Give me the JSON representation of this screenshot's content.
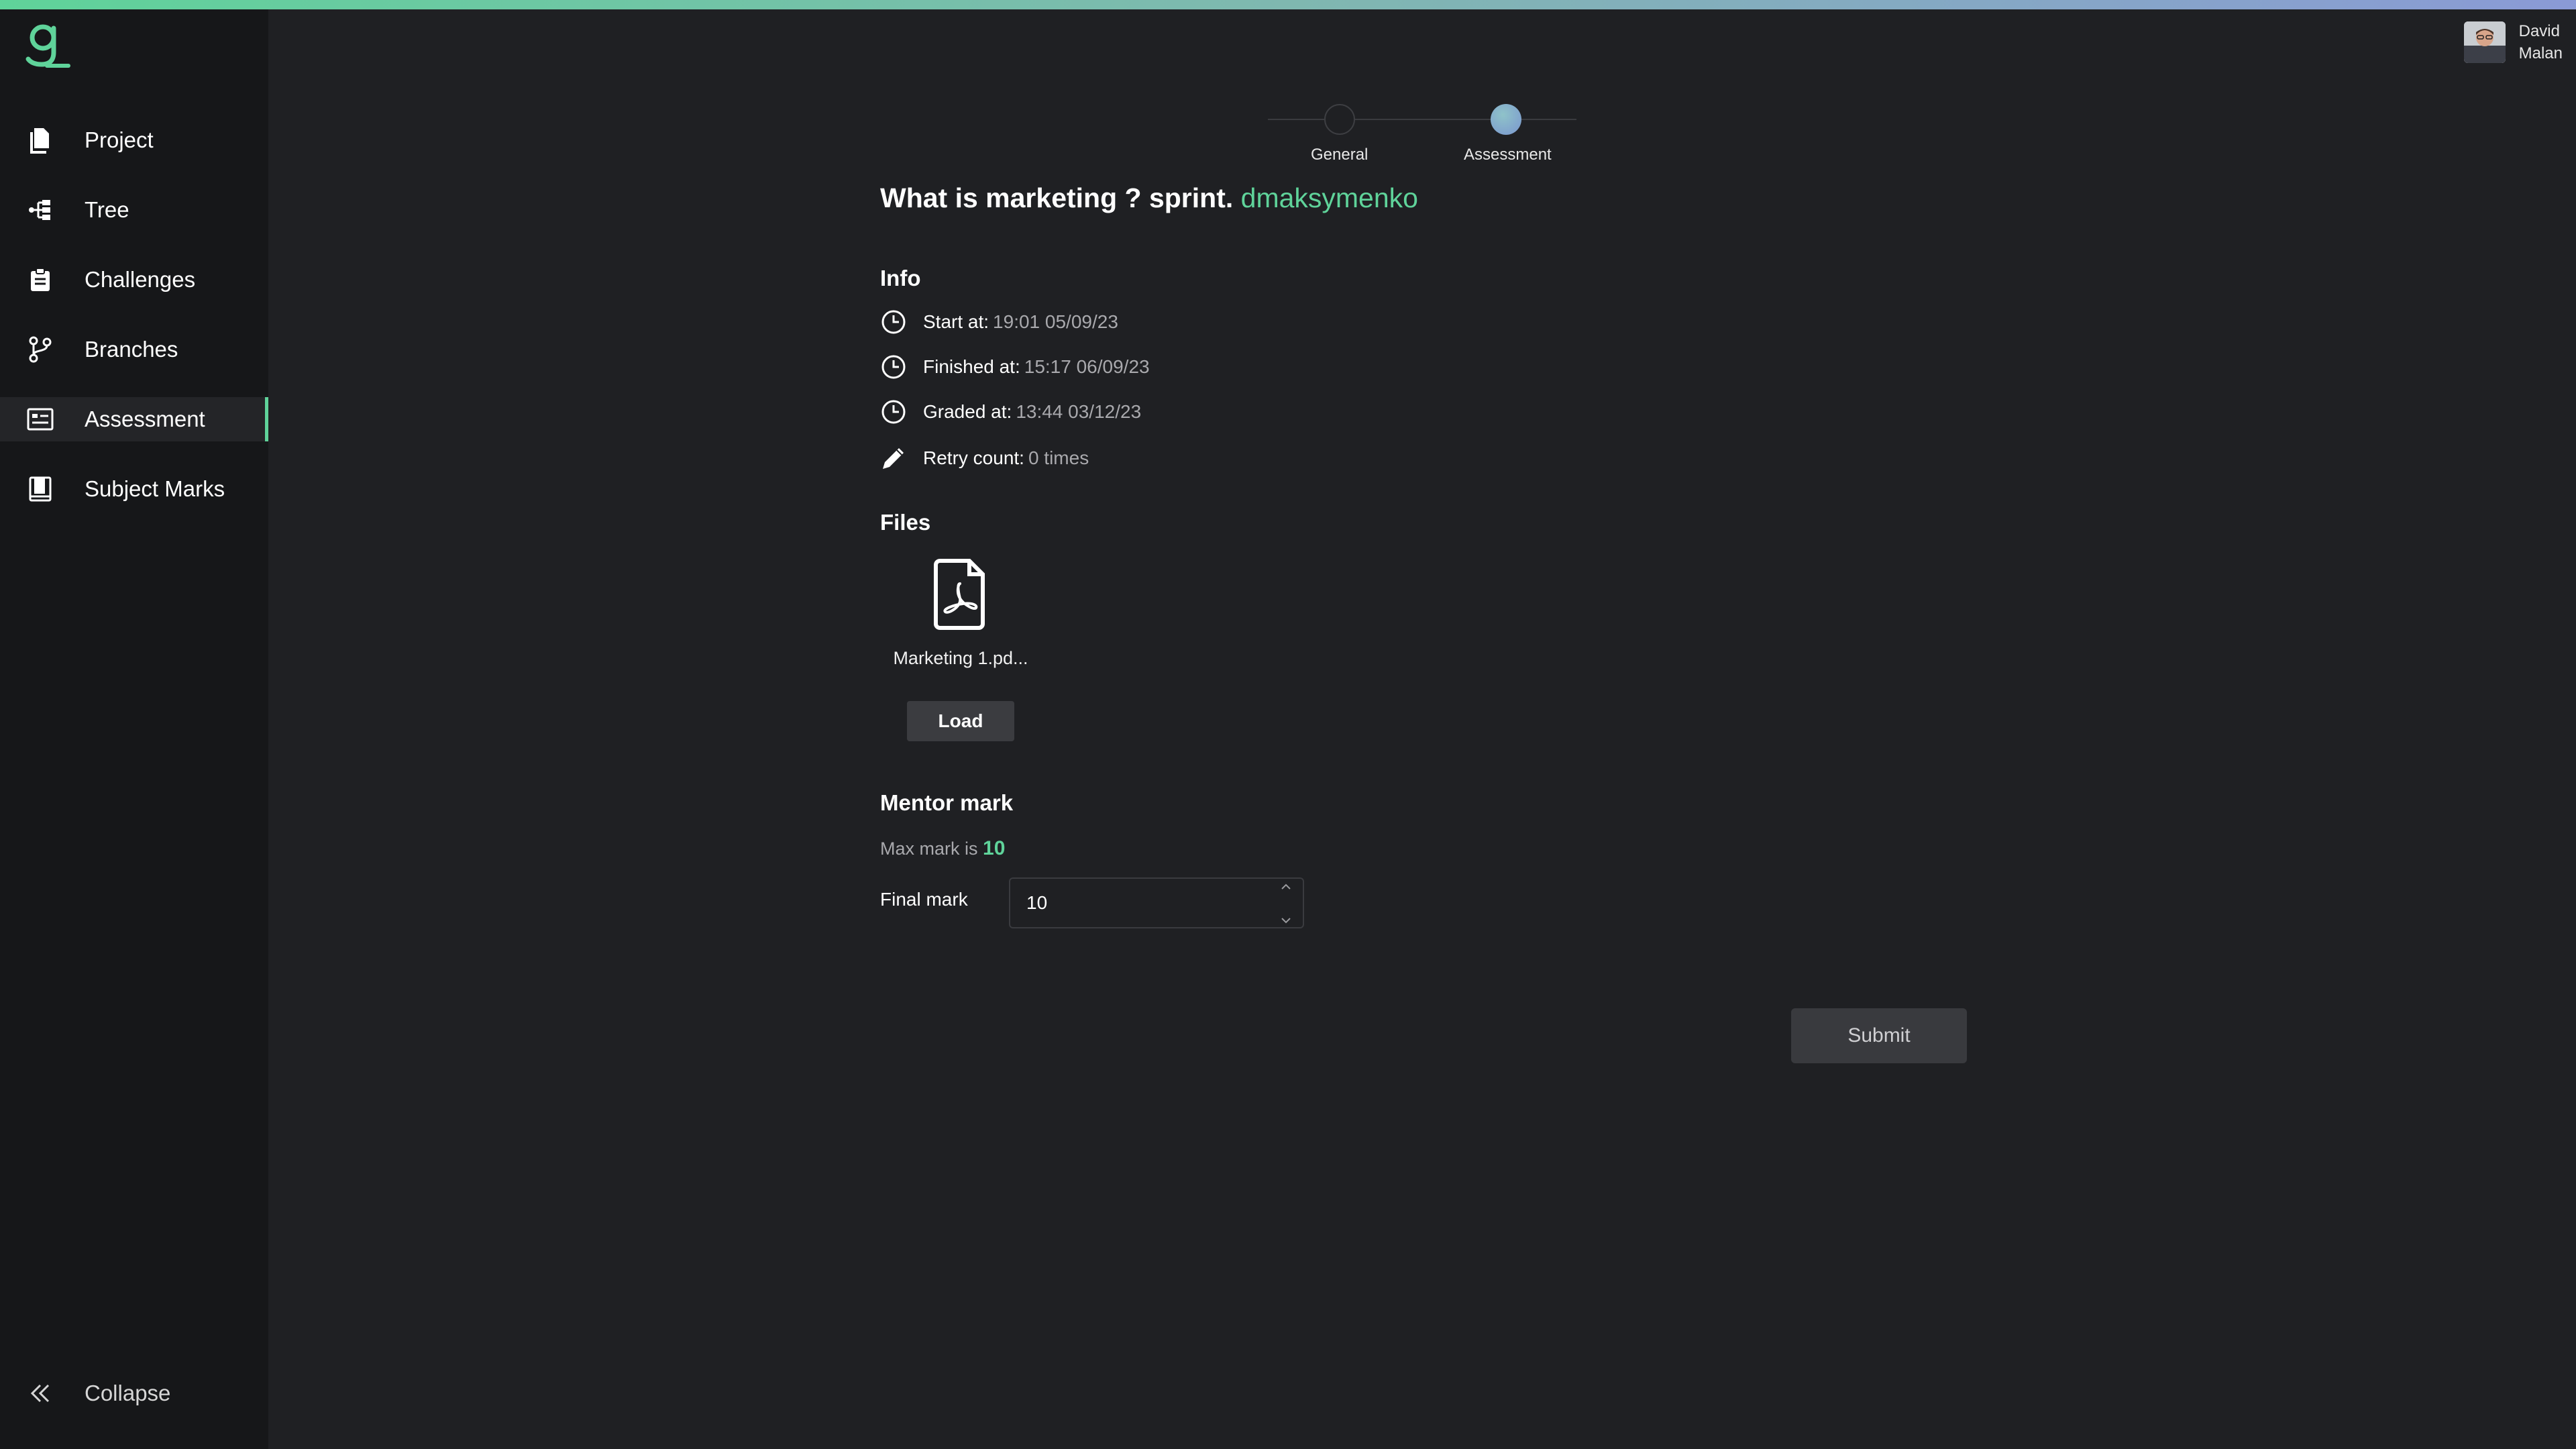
{
  "app": {
    "accent_color": "#5fd39a",
    "logo_icon": "g-logo-icon"
  },
  "sidebar": {
    "items": [
      {
        "label": "Project",
        "icon": "documents-icon"
      },
      {
        "label": "Tree",
        "icon": "tree-icon"
      },
      {
        "label": "Challenges",
        "icon": "clipboard-icon"
      },
      {
        "label": "Branches",
        "icon": "git-branch-icon"
      },
      {
        "label": "Assessment",
        "icon": "assessment-icon",
        "active": true
      },
      {
        "label": "Subject Marks",
        "icon": "book-icon"
      }
    ],
    "collapse_label": "Collapse"
  },
  "user": {
    "first_name": "David",
    "last_name": "Malan"
  },
  "stepper": {
    "steps": [
      {
        "label": "General",
        "active": false
      },
      {
        "label": "Assessment",
        "active": true
      }
    ]
  },
  "header": {
    "title": "What is marketing ? sprint.",
    "username": "dmaksymenko"
  },
  "info": {
    "heading": "Info",
    "start_label": "Start at:",
    "start_value": "19:01 05/09/23",
    "finished_label": "Finished at:",
    "finished_value": "15:17 06/09/23",
    "graded_label": "Graded at:",
    "graded_value": "13:44 03/12/23",
    "retry_label": "Retry count:",
    "retry_value": "0 times"
  },
  "files": {
    "heading": "Files",
    "items": [
      {
        "name": "Marketing 1.pd...",
        "icon": "pdf-file-icon"
      }
    ],
    "load_label": "Load"
  },
  "mentor_mark": {
    "heading": "Mentor mark",
    "max_mark_prefix": "Max mark is",
    "max_mark_value": "10",
    "final_mark_label": "Final mark",
    "final_mark_value": "10"
  },
  "actions": {
    "submit_label": "Submit"
  }
}
